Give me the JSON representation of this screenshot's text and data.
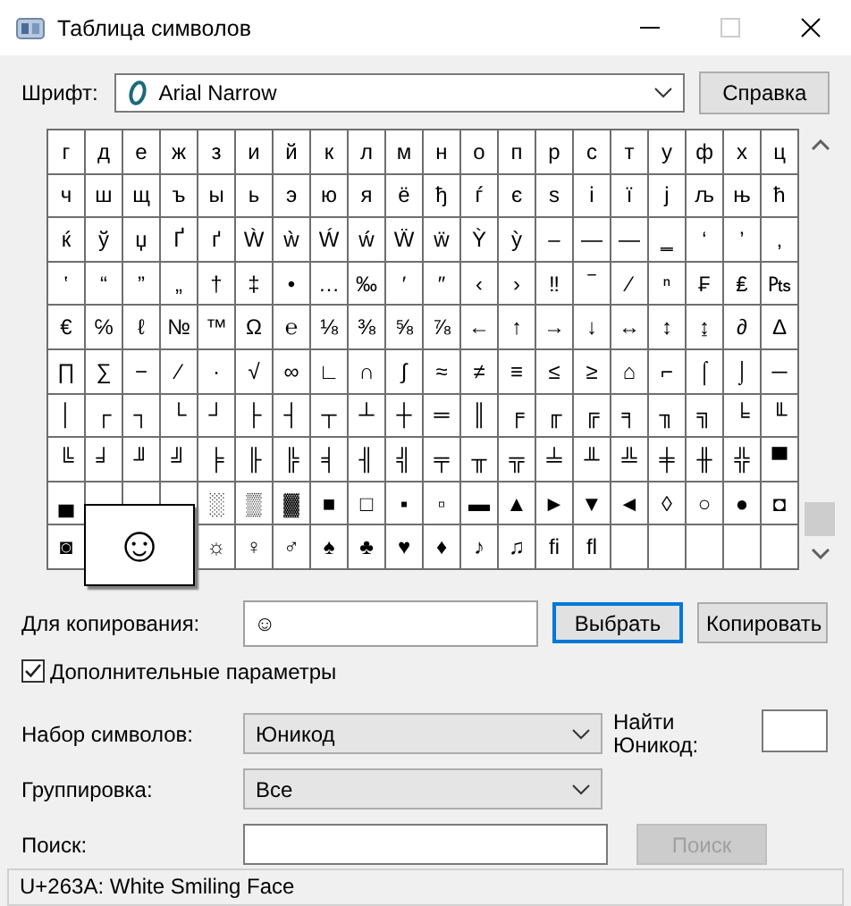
{
  "window": {
    "title": "Таблица символов"
  },
  "font": {
    "label": "Шрифт:",
    "value": "Arial Narrow"
  },
  "help_button": "Справка",
  "grid": {
    "rows": [
      [
        "г",
        "д",
        "е",
        "ж",
        "з",
        "и",
        "й",
        "к",
        "л",
        "м",
        "н",
        "о",
        "п",
        "р",
        "с",
        "т",
        "у",
        "ф",
        "х",
        "ц"
      ],
      [
        "ч",
        "ш",
        "щ",
        "ъ",
        "ы",
        "ь",
        "э",
        "ю",
        "я",
        "ё",
        "ђ",
        "ѓ",
        "є",
        "ѕ",
        "і",
        "ї",
        "ј",
        "љ",
        "њ",
        "ћ"
      ],
      [
        "ќ",
        "ў",
        "џ",
        "Ґ",
        "ґ",
        "Ẁ",
        "ẁ",
        "Ẃ",
        "ẃ",
        "Ẅ",
        "ẅ",
        "Ỳ",
        "ỳ",
        "–",
        "—",
        "―",
        "‗",
        "‘",
        "’",
        "‚"
      ],
      [
        "‛",
        "“",
        "”",
        "„",
        "†",
        "‡",
        "•",
        "…",
        "‰",
        "′",
        "″",
        "‹",
        "›",
        "‼",
        "‾",
        "⁄",
        "ⁿ",
        "₣",
        "₤",
        "₧"
      ],
      [
        "€",
        "℅",
        "ℓ",
        "№",
        "™",
        "Ω",
        "℮",
        "⅛",
        "⅜",
        "⅝",
        "⅞",
        "←",
        "↑",
        "→",
        "↓",
        "↔",
        "↕",
        "↨",
        "∂",
        "∆"
      ],
      [
        "∏",
        "∑",
        "−",
        "∕",
        "∙",
        "√",
        "∞",
        "∟",
        "∩",
        "∫",
        "≈",
        "≠",
        "≡",
        "≤",
        "≥",
        "⌂",
        "⌐",
        "⌠",
        "⌡",
        "─"
      ],
      [
        "│",
        "┌",
        "┐",
        "└",
        "┘",
        "├",
        "┤",
        "┬",
        "┴",
        "┼",
        "═",
        "║",
        "╒",
        "╓",
        "╔",
        "╕",
        "╖",
        "╗",
        "╘",
        "╙"
      ],
      [
        "╚",
        "╛",
        "╜",
        "╝",
        "╞",
        "╟",
        "╠",
        "╡",
        "╢",
        "╣",
        "╤",
        "╥",
        "╦",
        "╧",
        "╨",
        "╩",
        "╪",
        "╫",
        "╬",
        "▀"
      ],
      [
        "▄",
        null,
        null,
        null,
        "░",
        "▒",
        "▓",
        "■",
        "□",
        "▪",
        "▫",
        "▬",
        "▲",
        "►",
        "▼",
        "◄",
        "◊",
        "○",
        "●",
        "◘"
      ],
      [
        "◙",
        null,
        null,
        null,
        "☼",
        "♀",
        "♂",
        "♠",
        "♣",
        "♥",
        "♦",
        "♪",
        "♫",
        "ﬁ",
        "ﬂ",
        null,
        null,
        null,
        null,
        null
      ]
    ],
    "magnified": "☺"
  },
  "copy": {
    "label": "Для копирования:",
    "value": "☺",
    "select_button": "Выбрать",
    "copy_button": "Копировать"
  },
  "advanced": {
    "label": "Дополнительные параметры",
    "checked": true
  },
  "charset": {
    "label": "Набор символов:",
    "value": "Юникод"
  },
  "find_unicode": {
    "label": "Найти Юникод:"
  },
  "grouping": {
    "label": "Группировка:",
    "value": "Все"
  },
  "search": {
    "label": "Поиск:",
    "button": "Поиск",
    "button_disabled": true
  },
  "status_bar": "U+263A: White Smiling Face"
}
